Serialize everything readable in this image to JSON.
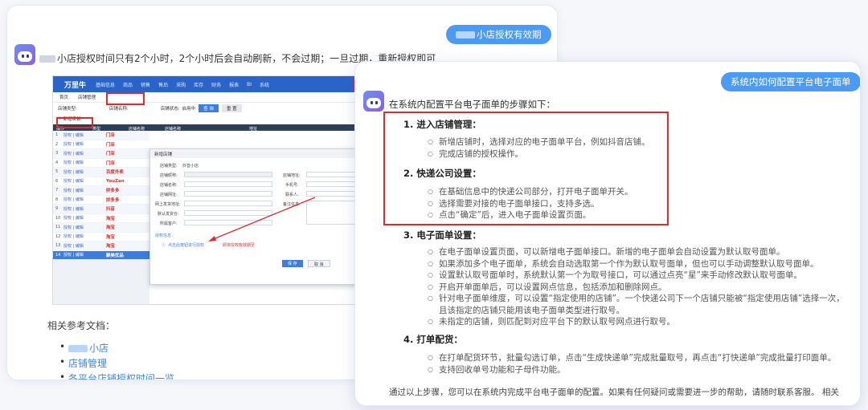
{
  "back_card": {
    "user_bubble": "小店授权有效期",
    "answer": "小店授权时间只有2个小时，2个小时后会自动刷新，不会过期；一旦过期，重新授权即可",
    "screenshot": {
      "logo": "万里牛",
      "nav": [
        "基础信息",
        "商品",
        "销售",
        "售后",
        "采购",
        "库存",
        "财务",
        "报表",
        "BI",
        "系统"
      ],
      "tabs": [
        "首页",
        "店铺管理"
      ],
      "filter_label": "店铺类型:",
      "filter_name_label": "店铺名称:",
      "filter_status_label": "店铺状态:",
      "filter_status_value": "启用中",
      "query_btn": "查 询",
      "reset_btn": "重 置",
      "add_btn": "新增店铺",
      "columns": [
        "操作",
        "类型",
        "店铺名称",
        "店铺名称",
        "地址"
      ],
      "row_action": "授权 | 编辑",
      "rows": [
        {
          "idx": "1",
          "plat": "门店"
        },
        {
          "idx": "2",
          "plat": "门店"
        },
        {
          "idx": "3",
          "plat": "门店"
        },
        {
          "idx": "4",
          "plat": "门店"
        },
        {
          "idx": "5",
          "plat": "百度外卖"
        },
        {
          "idx": "6",
          "plat": "YouZan"
        },
        {
          "idx": "7",
          "plat": "拼多多"
        },
        {
          "idx": "8",
          "plat": "拼多多"
        },
        {
          "idx": "9",
          "plat": "抖音"
        },
        {
          "idx": "10",
          "plat": "淘宝"
        },
        {
          "idx": "11",
          "plat": "淘宝"
        },
        {
          "idx": "12",
          "plat": "淘宝"
        },
        {
          "idx": "13",
          "plat": "淘宝"
        },
        {
          "idx": "14",
          "plat": "聚美优品"
        }
      ],
      "dialog": {
        "title": "新增店铺",
        "type_label": "店铺类型:",
        "type_value": "抖音小店",
        "name_label": "店铺昵称:",
        "fields_left": [
          "店铺名称:",
          "店铺网址:",
          "网上发货地址:",
          "默认发货仓:",
          "所属客户:"
        ],
        "fields_right": [
          "店铺地址:",
          "手机号:",
          "联系人:",
          "备注信息:"
        ],
        "auth_section": "授权信息",
        "auth_hint": "点击此按钮进行授权",
        "expire_hint": "即将授权有效期至",
        "save_btn": "保 存",
        "cancel_btn": "取 消"
      }
    },
    "refs_title": "相关参考文档：",
    "refs": [
      "小店",
      "店铺管理",
      "各平台店铺授权时间一览"
    ]
  },
  "front_card": {
    "user_bubble": "系统内如何配置平台电子面单",
    "intro": "在系统内配置平台电子面单的步骤如下：",
    "sections": [
      {
        "title": "1. 进入店铺管理：",
        "items": [
          "新增店铺时，选择对应的电子面单平台，例如抖音店铺。",
          "完成店铺的授权操作。"
        ]
      },
      {
        "title": "2. 快递公司设置：",
        "items": [
          "在基础信息中的快递公司部分，打开电子面单开关。",
          "选择需要对接的电子面单接口，支持多选。",
          "点击“确定”后，进入电子面单设置页面。"
        ]
      },
      {
        "title": "3. 电子面单设置：",
        "items": [
          "在电子面单设置页面，可以新增电子面单接口。新增的电子面单会自动设置为默认取号面单。",
          "如果添加多个电子面单，系统会自动选取第一个作为默认取号面单，但也可以手动调整默认取号面单。",
          "设置默认取号面单时，系统默认第一个为取号接口，可以通过点亮“星”来手动修改默认取号面单。",
          "开启开单面单后，可以设置网点信息，包括添加和删除网点。",
          "针对电子面单维度，可以设置“指定使用的店铺”。一个快递公司下一个店铺只能被“指定使用店铺”选择一次，",
          "且该指定的店铺只能用该电子面单类型进行取号。",
          "未指定的店铺，则匹配到对应平台下的默认取号网点进行取号。"
        ]
      },
      {
        "title": "4. 打单配货：",
        "items": [
          "在打单配货环节，批量勾选订单，点击“生成快递单”完成批量取号，再点击“打快递单”完成批量打印面单。",
          "支持回收单号功能和子母件功能。"
        ]
      }
    ],
    "outro": "通过以上步骤，您可以在系统内完成平台电子面单的配置。如果有任何疑问或需要进一步的帮助，请随时联系客服。 相关"
  },
  "colors": {
    "accent": "#4b9bf5",
    "highlight_box": "#e02b2b",
    "link": "#3a86e8"
  }
}
